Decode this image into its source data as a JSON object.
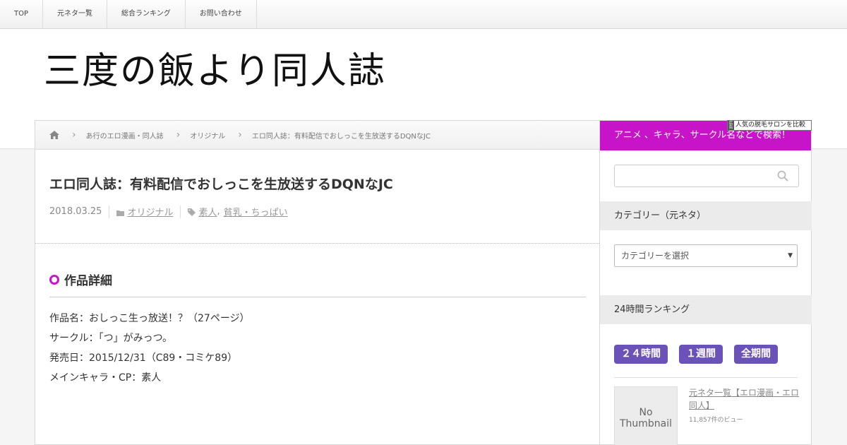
{
  "nav": {
    "items": [
      "TOP",
      "元ネタ一覧",
      "総合ランキング",
      "お問い合わせ"
    ]
  },
  "site": {
    "title": "三度の飯より同人誌"
  },
  "breadcrumb": {
    "home_icon": "home-icon",
    "items": [
      "あ行のエロ漫画・同人誌",
      "オリジナル",
      "エロ同人誌：有料配信でおしっこを生放送するDQNなJC"
    ]
  },
  "post": {
    "title": "エロ同人誌：有料配信でおしっこを生放送するDQNなJC",
    "date": "2018.03.25",
    "category": "オリジナル",
    "tag1": "素人",
    "tag_sep": ",",
    "tag2": "貧乳・ちっぱい"
  },
  "details": {
    "heading": "作品詳細",
    "lines": [
      "作品名：おしっこ生っ放送！？（27ページ）",
      "サークル：「つ」がみっつ。",
      "発売日：2015/12/31（C89・コミケ89）",
      "メインキャラ・CP：素人"
    ]
  },
  "ad": {
    "label": "人気の脱毛サロンを比較",
    "mark": "広告"
  },
  "sidebar": {
    "search_banner": "アニメ 、キャラ、サークル名などで検索！",
    "search_placeholder": "",
    "category_heading": "カテゴリー（元ネタ）",
    "category_select": "カテゴリーを選択",
    "ranking_heading": "24時間ランキング",
    "ranking_tabs": [
      "２４時間",
      "１週間",
      "全期間"
    ],
    "ranking_item": {
      "thumb_text": "No Thumbnail",
      "title": "元ネタ一覧【エロ漫画・エロ同人】",
      "views": "11,857件のビュー"
    }
  },
  "colors": {
    "accent": "#c814c8",
    "tab": "#6b52b8"
  }
}
